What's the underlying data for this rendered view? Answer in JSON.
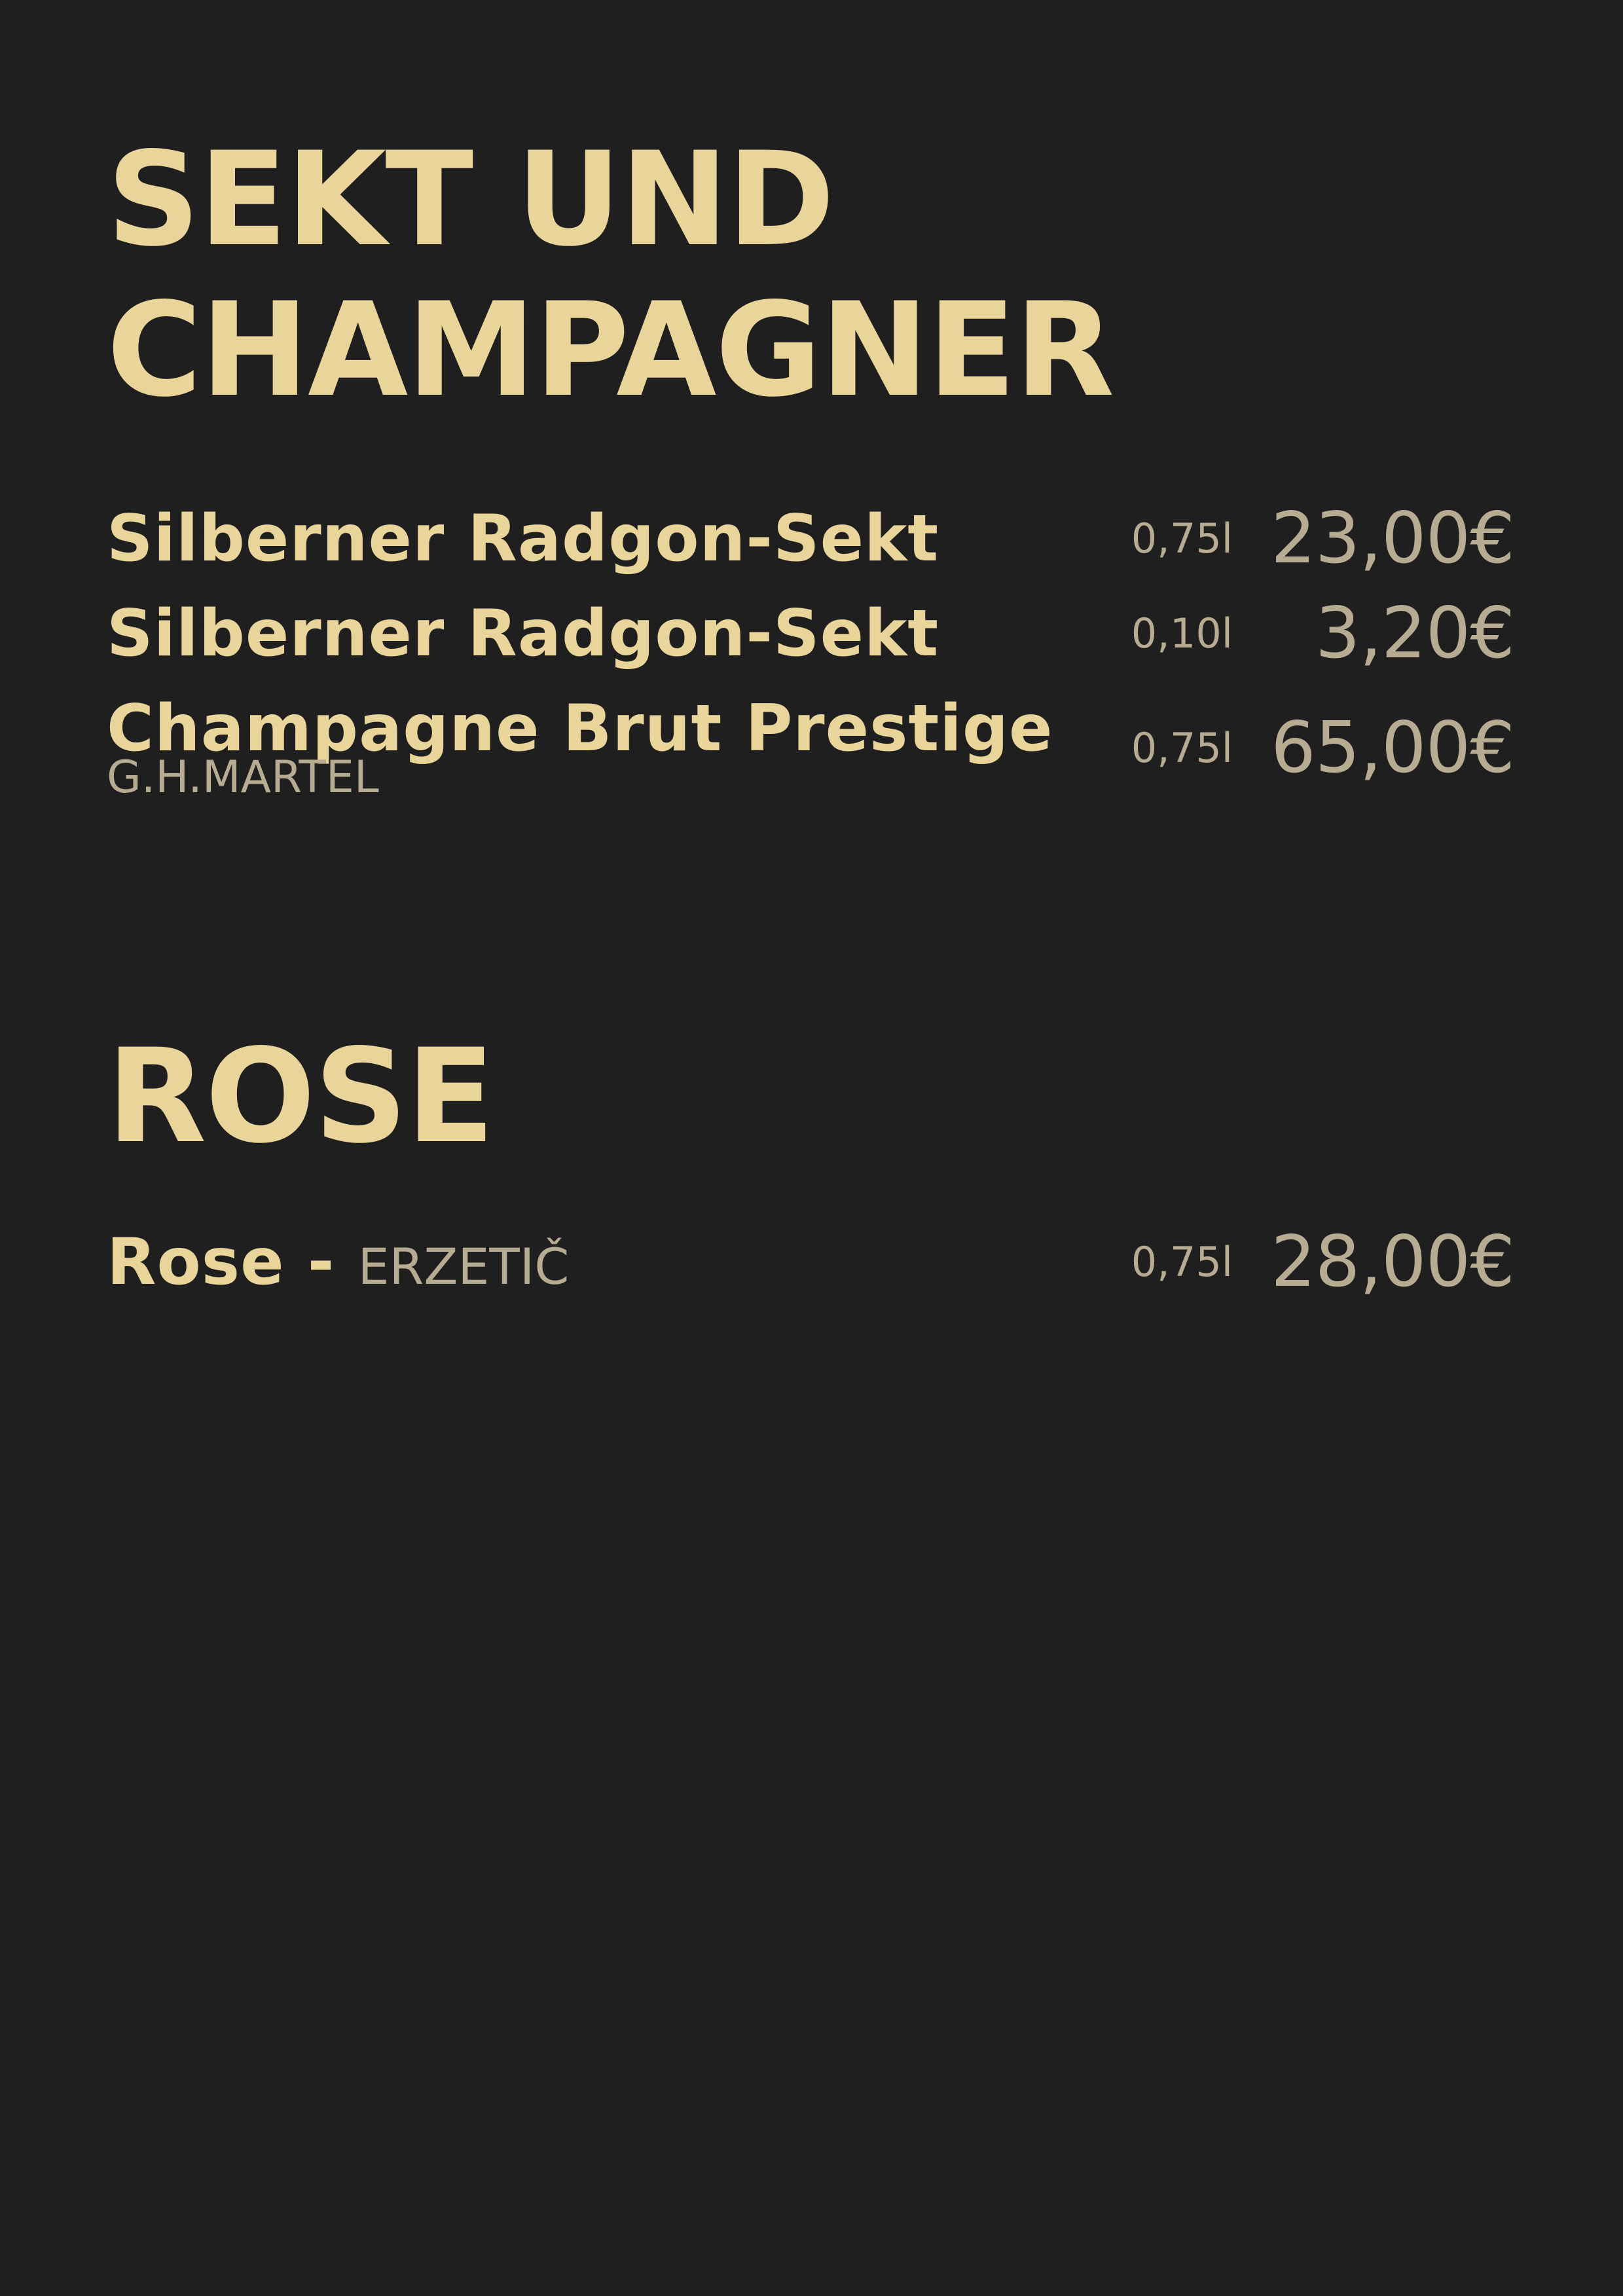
{
  "sections": [
    {
      "heading_lines": [
        "SEKT UND",
        "CHAMPAGNER"
      ],
      "items": [
        {
          "name": "Silberner Radgon-Sekt",
          "volume": "0,75l",
          "price": "23,00€"
        },
        {
          "name": "Silberner Radgon-Sekt",
          "volume": "0,10l",
          "price": "3,20€"
        },
        {
          "name": "Champagne Brut Prestige",
          "producer": "G.H.MARTEL",
          "volume": "0,75l",
          "price": "65,00€"
        }
      ]
    },
    {
      "heading_lines": [
        "ROSE"
      ],
      "items": [
        {
          "name": "Rose - ",
          "producer": "ERZETIČ",
          "volume": "0,75l",
          "price": "28,00€"
        }
      ]
    }
  ],
  "colors": {
    "background": "#201f1f",
    "heading": "#e9d49a",
    "item_name": "#e9d49a",
    "secondary": "#b7ab92"
  }
}
